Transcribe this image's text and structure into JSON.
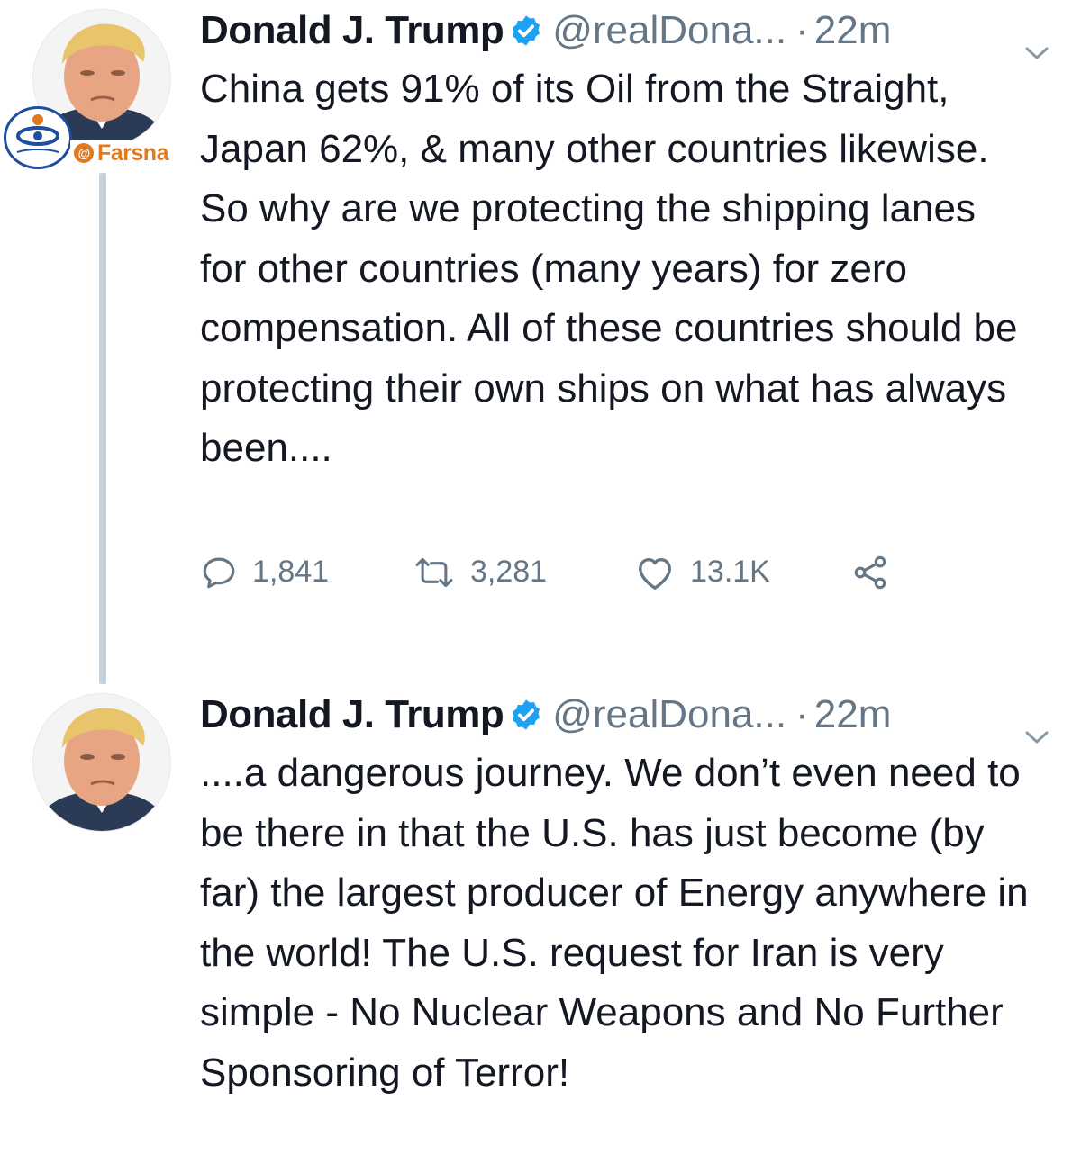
{
  "watermark": {
    "at_symbol": "@",
    "text": "Farsna"
  },
  "tweets": [
    {
      "author": {
        "name": "Donald J. Trump",
        "handle": "@realDona...",
        "verified": true
      },
      "separator": "·",
      "time": "22m",
      "text": "China gets 91% of its Oil from the Straight, Japan 62%, & many other countries likewise. So why are we protecting the shipping lanes for other countries (many years) for zero compensation. All of these countries should be protecting their own ships on what has always been....",
      "stats": {
        "replies": "1,841",
        "retweets": "3,281",
        "likes": "13.1K"
      }
    },
    {
      "author": {
        "name": "Donald J. Trump",
        "handle": "@realDona...",
        "verified": true
      },
      "separator": "·",
      "time": "22m",
      "text": "....a dangerous journey. We don’t even need to be there in that the U.S. has just become (by far) the largest producer of Energy anywhere in the world! The U.S. request for Iran is very simple - No Nuclear Weapons and No Further Sponsoring of Terror!"
    }
  ],
  "colors": {
    "text": "#141823",
    "secondary": "#657786",
    "verified_badge": "#1da1f2",
    "thread_line": "#c7d3dc",
    "watermark_orange": "#e07a1e",
    "watermark_blue": "#1f4e9e"
  },
  "icons": {
    "verified": "verified-badge-icon",
    "menu": "chevron-down-icon",
    "reply": "reply-icon",
    "retweet": "retweet-icon",
    "like": "heart-icon",
    "share": "share-icon"
  }
}
